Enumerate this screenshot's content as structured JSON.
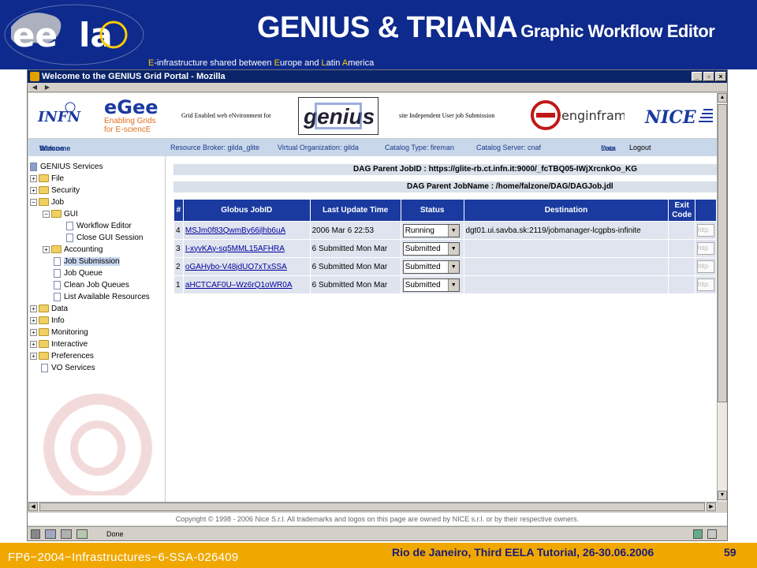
{
  "slide": {
    "title_main": "GENIUS & TRIANA",
    "title_sub": "Graphic Workflow Editor",
    "tagline_parts": [
      "E",
      "-infrastructure shared between ",
      "E",
      "urope and ",
      "L",
      "atin ",
      "A",
      "merica"
    ],
    "footer_left": "FP6−2004−Infrastructures−6-SSA-026409",
    "footer_center": "Rio de Janeiro, Third EELA Tutorial, 26-30.06.2006",
    "page_number": "59",
    "colors": {
      "header_bg": "#0e2a8c",
      "footer_bg": "#f0a800"
    }
  },
  "browser": {
    "window_title": "Welcome to the GENIUS Grid Portal - Mozilla",
    "status_text": "Done",
    "copyright": "Copyright © 1998 - 2006 Nice S.r.l. All trademarks and logos on this page are owned by NICE s.r.l. or by their respective owners."
  },
  "logos": {
    "infn": "INFN",
    "egee_line1": "Enabling Grids",
    "egee_line2": "for E-sciencE",
    "genius_caption_left": "Grid Enabled web eNvironment for",
    "genius": "genius",
    "genius_caption_right": "site Independent User job Submission",
    "enginframe": "enginframe",
    "nice": "NICE"
  },
  "portal_nav": {
    "welcome": "Welcome",
    "user": "falzone",
    "resource_broker": "Resource Broker: gilda_glite",
    "vo": "Virtual Organization: gilda",
    "catalog_type": "Catalog Type: fireman",
    "catalog_server": "Catalog Server: cnaf",
    "your_data_1": "Your",
    "your_data_2": "Data",
    "logout": "Logout"
  },
  "sidebar": {
    "root": "GENIUS Services",
    "items": [
      "File",
      "Security",
      "Job",
      "GUI",
      "Workflow Editor",
      "Close GUI Session",
      "Accounting",
      "Job Submission",
      "Job Queue",
      "Clean Job Queues",
      "List Available Resources",
      "Data",
      "Info",
      "Monitoring",
      "Interactive",
      "Preferences",
      "VO Services"
    ]
  },
  "content": {
    "dag_jobid": "DAG Parent JobID : https://glite-rb.ct.infn.it:9000/_fcTBQ05-IWjXrcnkOo_KG",
    "dag_jobname": "DAG Parent JobName : /home/falzone/DAG/DAGJob.jdl",
    "columns": [
      "#",
      "Globus JobID",
      "Last Update Time",
      "Status",
      "Destination",
      "Exit Code"
    ],
    "rows": [
      {
        "num": "4",
        "jobid": "MSJm0f83QwmBy66jlhb6uA",
        "time": "2006 Mar 6 22:53",
        "status": "Running",
        "dest": "dgt01.ui.savba.sk:2119/jobmanager-lcgpbs-infinite",
        "btn": "http"
      },
      {
        "num": "3",
        "jobid": "I-xyvKAy-sq5MML15AFHRA",
        "time": "6 Submitted Mon Mar",
        "status": "Submitted",
        "dest": "",
        "btn": "http"
      },
      {
        "num": "2",
        "jobid": "oGAHybo-V48jdUO7xTxSSA",
        "time": "6 Submitted Mon Mar",
        "status": "Submitted",
        "dest": "",
        "btn": "http"
      },
      {
        "num": "1",
        "jobid": "aHCTCAF0U–Wz6rQ1oWR0A",
        "time": "6 Submitted Mon Mar",
        "status": "Submitted",
        "dest": "",
        "btn": "http"
      }
    ]
  }
}
